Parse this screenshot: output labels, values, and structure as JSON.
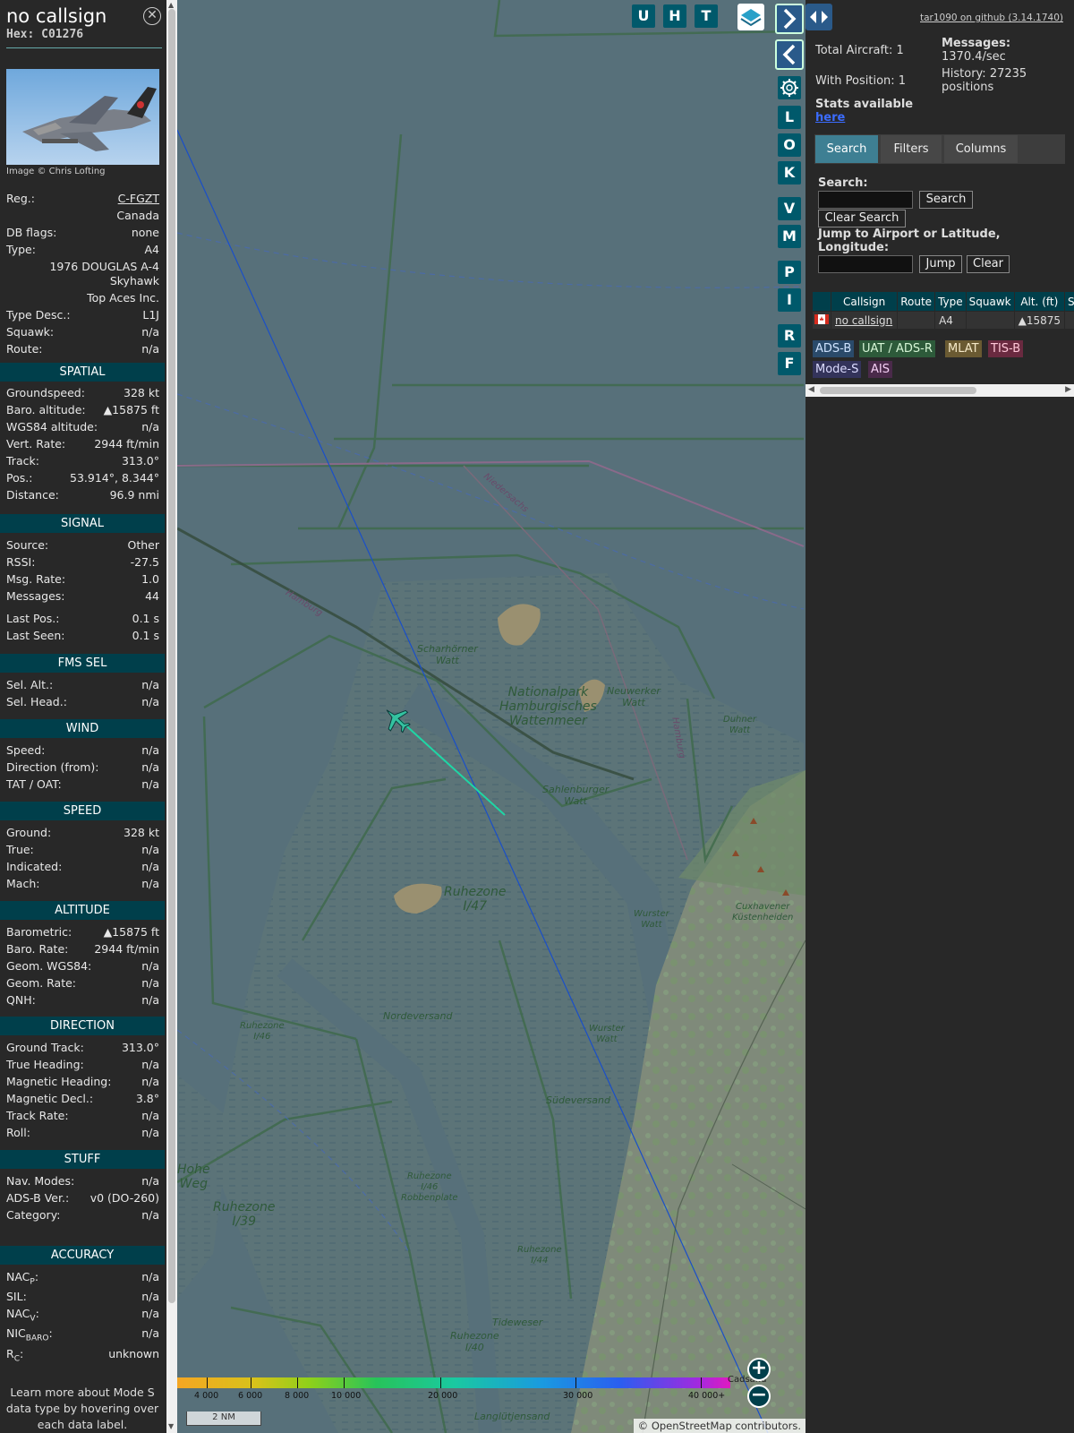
{
  "detail": {
    "callsign": "no callsign",
    "hex": "Hex: C01276",
    "image_credit": "Image © Chris Lofting",
    "info": {
      "reg_label": "Reg.:",
      "reg_value": "C-FGZT",
      "country": "Canada",
      "dbflags_label": "DB flags:",
      "dbflags_value": "none",
      "type_label": "Type:",
      "type_value": "A4",
      "model_line1": "1976 DOUGLAS A-4",
      "model_line2": "Skyhawk",
      "operator": "Top Aces Inc.",
      "typedesc_label": "Type Desc.:",
      "typedesc_value": "L1J",
      "squawk_label": "Squawk:",
      "squawk_value": "n/a",
      "route_label": "Route:",
      "route_value": "n/a"
    },
    "sections": {
      "spatial": "SPATIAL",
      "signal": "SIGNAL",
      "fms": "FMS SEL",
      "wind": "WIND",
      "speed": "SPEED",
      "altitude": "ALTITUDE",
      "direction": "DIRECTION",
      "stuff": "STUFF",
      "accuracy": "ACCURACY"
    },
    "spatial": [
      {
        "label": "Groundspeed:",
        "value": "328 kt"
      },
      {
        "label": "Baro. altitude:",
        "value": "▲15875 ft"
      },
      {
        "label": "WGS84 altitude:",
        "value": "n/a"
      },
      {
        "label": "Vert. Rate:",
        "value": "2944 ft/min"
      },
      {
        "label": "Track:",
        "value": "313.0°"
      },
      {
        "label": "Pos.:",
        "value": "53.914°, 8.344°"
      },
      {
        "label": "Distance:",
        "value": "96.9 nmi"
      }
    ],
    "signal": [
      {
        "label": "Source:",
        "value": "Other"
      },
      {
        "label": "RSSI:",
        "value": "-27.5"
      },
      {
        "label": "Msg. Rate:",
        "value": "1.0"
      },
      {
        "label": "Messages:",
        "value": "44"
      },
      {
        "label": "Last Pos.:",
        "value": "0.1 s"
      },
      {
        "label": "Last Seen:",
        "value": "0.1 s"
      }
    ],
    "fms": [
      {
        "label": "Sel. Alt.:",
        "value": "n/a"
      },
      {
        "label": "Sel. Head.:",
        "value": "n/a"
      }
    ],
    "wind": [
      {
        "label": "Speed:",
        "value": "n/a"
      },
      {
        "label": "Direction (from):",
        "value": "n/a"
      },
      {
        "label": "TAT / OAT:",
        "value": "n/a"
      }
    ],
    "speed": [
      {
        "label": "Ground:",
        "value": "328 kt"
      },
      {
        "label": "True:",
        "value": "n/a"
      },
      {
        "label": "Indicated:",
        "value": "n/a"
      },
      {
        "label": "Mach:",
        "value": "n/a"
      }
    ],
    "altitude": [
      {
        "label": "Barometric:",
        "value": "▲15875 ft"
      },
      {
        "label": "Baro. Rate:",
        "value": "2944 ft/min"
      },
      {
        "label": "Geom. WGS84:",
        "value": "n/a"
      },
      {
        "label": "Geom. Rate:",
        "value": "n/a"
      },
      {
        "label": "QNH:",
        "value": "n/a"
      }
    ],
    "direction": [
      {
        "label": "Ground Track:",
        "value": "313.0°"
      },
      {
        "label": "True Heading:",
        "value": "n/a"
      },
      {
        "label": "Magnetic Heading:",
        "value": "n/a"
      },
      {
        "label": "Magnetic Decl.:",
        "value": "3.8°"
      },
      {
        "label": "Track Rate:",
        "value": "n/a"
      },
      {
        "label": "Roll:",
        "value": "n/a"
      }
    ],
    "stuff": [
      {
        "label": "Nav. Modes:",
        "value": "n/a"
      },
      {
        "label": "ADS-B Ver.:",
        "value": "v0 (DO-260)"
      },
      {
        "label": "Category:",
        "value": "n/a"
      }
    ],
    "accuracy": [
      {
        "label": "NAC",
        "sub": "P",
        "value": "n/a"
      },
      {
        "label": "SIL:",
        "sub": "",
        "value": "n/a"
      },
      {
        "label": "NAC",
        "sub": "V",
        "value": "n/a"
      },
      {
        "label": "NIC",
        "sub": "BARO",
        "value": "n/a"
      },
      {
        "label": "R",
        "sub": "C",
        "value": "unknown"
      }
    ],
    "footer": "Learn more about Mode S data type by hovering over each data label."
  },
  "map": {
    "labels": [
      {
        "text": "Nationalpark\nHamburgisches\nWattenmeer",
        "size": 14
      },
      {
        "text": "Scharhörner\nWatt",
        "size": 11
      },
      {
        "text": "Neuwerker\nWatt",
        "size": 11
      },
      {
        "text": "Duhner\nWatt",
        "size": 10
      },
      {
        "text": "Sahlenburger\nWatt",
        "size": 11
      },
      {
        "text": "Ruhezone\nI/47",
        "size": 14
      },
      {
        "text": "Cuxhavener\nKüstenheiden",
        "size": 10
      },
      {
        "text": "Wurster\nWatt",
        "size": 10
      },
      {
        "text": "Nordeversand",
        "size": 11
      },
      {
        "text": "Ruhezone\nI/46",
        "size": 10
      },
      {
        "text": "Wurster\nWatt",
        "size": 10
      },
      {
        "text": "Südeversand",
        "size": 11
      },
      {
        "text": "Hohe\nWeg",
        "size": 14
      },
      {
        "text": "Ruhezone\nI/39",
        "size": 14
      },
      {
        "text": "Ruhezone\nI/46\nRobbenplate",
        "size": 10
      },
      {
        "text": "Ruhezone\nI/44",
        "size": 10
      },
      {
        "text": "Tideweser",
        "size": 11
      },
      {
        "text": "Ruhezone\nI/40",
        "size": 11
      },
      {
        "text": "Langlütjensand",
        "size": 11
      },
      {
        "text": "Hamburg",
        "size": 10
      },
      {
        "text": "Niedersachs",
        "size": 10
      },
      {
        "text": "Hamburg",
        "size": 10
      }
    ],
    "buttons": [
      "U",
      "H",
      "T",
      "L",
      "O",
      "K",
      "V",
      "M",
      "P",
      "I",
      "R",
      "F"
    ],
    "legend_ticks": [
      "4 000",
      "6 000",
      "8 000",
      "10 000",
      "20 000",
      "30 000",
      "40 000+"
    ],
    "scale": "2 NM",
    "attribution": "© OpenStreetMap contributors.",
    "bottom_label": "Cadsand"
  },
  "sidebar": {
    "github": "tar1090 on github (3.14.1740)",
    "total_aircraft": "Total Aircraft: 1",
    "with_position": "With Position: 1",
    "stats_available": "Stats available",
    "stats_link": "here",
    "messages_label": "Messages:",
    "messages_value": "1370.4/sec",
    "history_label": "History: 27235",
    "history_value": "positions",
    "tabs": [
      "Search",
      "Filters",
      "Columns"
    ],
    "search_label": "Search:",
    "search_button": "Search",
    "clear_search_button": "Clear Search",
    "jump_label": "Jump to Airport or Latitude, Longitude:",
    "jump_button": "Jump",
    "clear_button": "Clear",
    "table": {
      "headers": [
        "Callsign",
        "Route",
        "Type",
        "Squawk",
        "Alt. (ft)",
        "S"
      ],
      "row": {
        "callsign": "no callsign",
        "route": "",
        "type": "A4",
        "squawk": "",
        "alt": "▲15875"
      }
    },
    "badges": [
      {
        "text": "ADS-B",
        "bg": "#2a4a6a",
        "fg": "#cfe3ff"
      },
      {
        "text": "UAT / ADS-R",
        "bg": "#2d5a3a",
        "fg": "#d6f5d6"
      },
      {
        "text": "MLAT",
        "bg": "#6a5a32",
        "fg": "#f5e9c8"
      },
      {
        "text": "TIS-B",
        "bg": "#6a2a40",
        "fg": "#ffc7d8"
      },
      {
        "text": "Mode-S",
        "bg": "#33335a",
        "fg": "#dcdcff"
      },
      {
        "text": "AIS",
        "bg": "#4a2a4a",
        "fg": "#f5d0f5"
      }
    ]
  },
  "colors": {
    "section": "#003f4b",
    "map_sea": "#57707a",
    "aircraft": "#34c2a0",
    "button": "#00596b"
  }
}
